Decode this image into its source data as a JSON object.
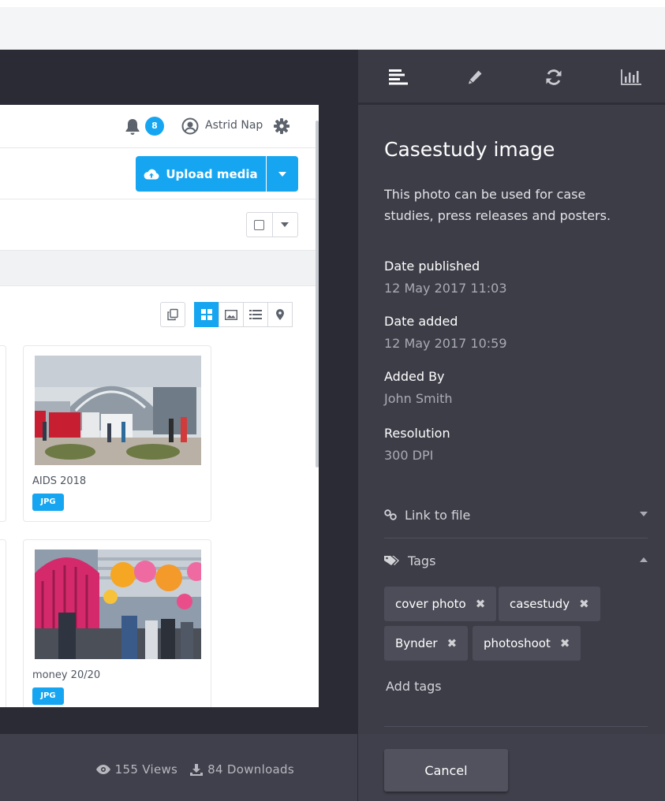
{
  "header": {
    "notifications_count": "8",
    "user_name": "Astrid Nap"
  },
  "toolbar": {
    "upload_label": "Upload media"
  },
  "assets": [
    {
      "name": "AIDS 2018",
      "type": "JPG"
    },
    {
      "name": "money 20/20",
      "type": "JPG"
    }
  ],
  "stats": {
    "views": "155 Views",
    "downloads": "84 Downloads"
  },
  "panel": {
    "title": "Casestudy image",
    "description": "This photo can be used for case studies, press releases and posters.",
    "meta": [
      {
        "label": "Date published",
        "value": "12 May  2017 11:03"
      },
      {
        "label": "Date added",
        "value": "12 May  2017 10:59"
      },
      {
        "label": "Added By",
        "value": "John Smith"
      },
      {
        "label": "Resolution",
        "value": "300 DPI"
      }
    ],
    "link_to_file": "Link to file",
    "tags_label": "Tags",
    "tags": [
      "cover photo",
      "casestudy",
      "Bynder",
      "photoshoot"
    ],
    "add_tags": "Add tags",
    "cancel": "Cancel"
  },
  "colors": {
    "accent": "#16a6f1",
    "panel_bg": "#3d3d48",
    "dark_bg": "#2b2b35"
  }
}
